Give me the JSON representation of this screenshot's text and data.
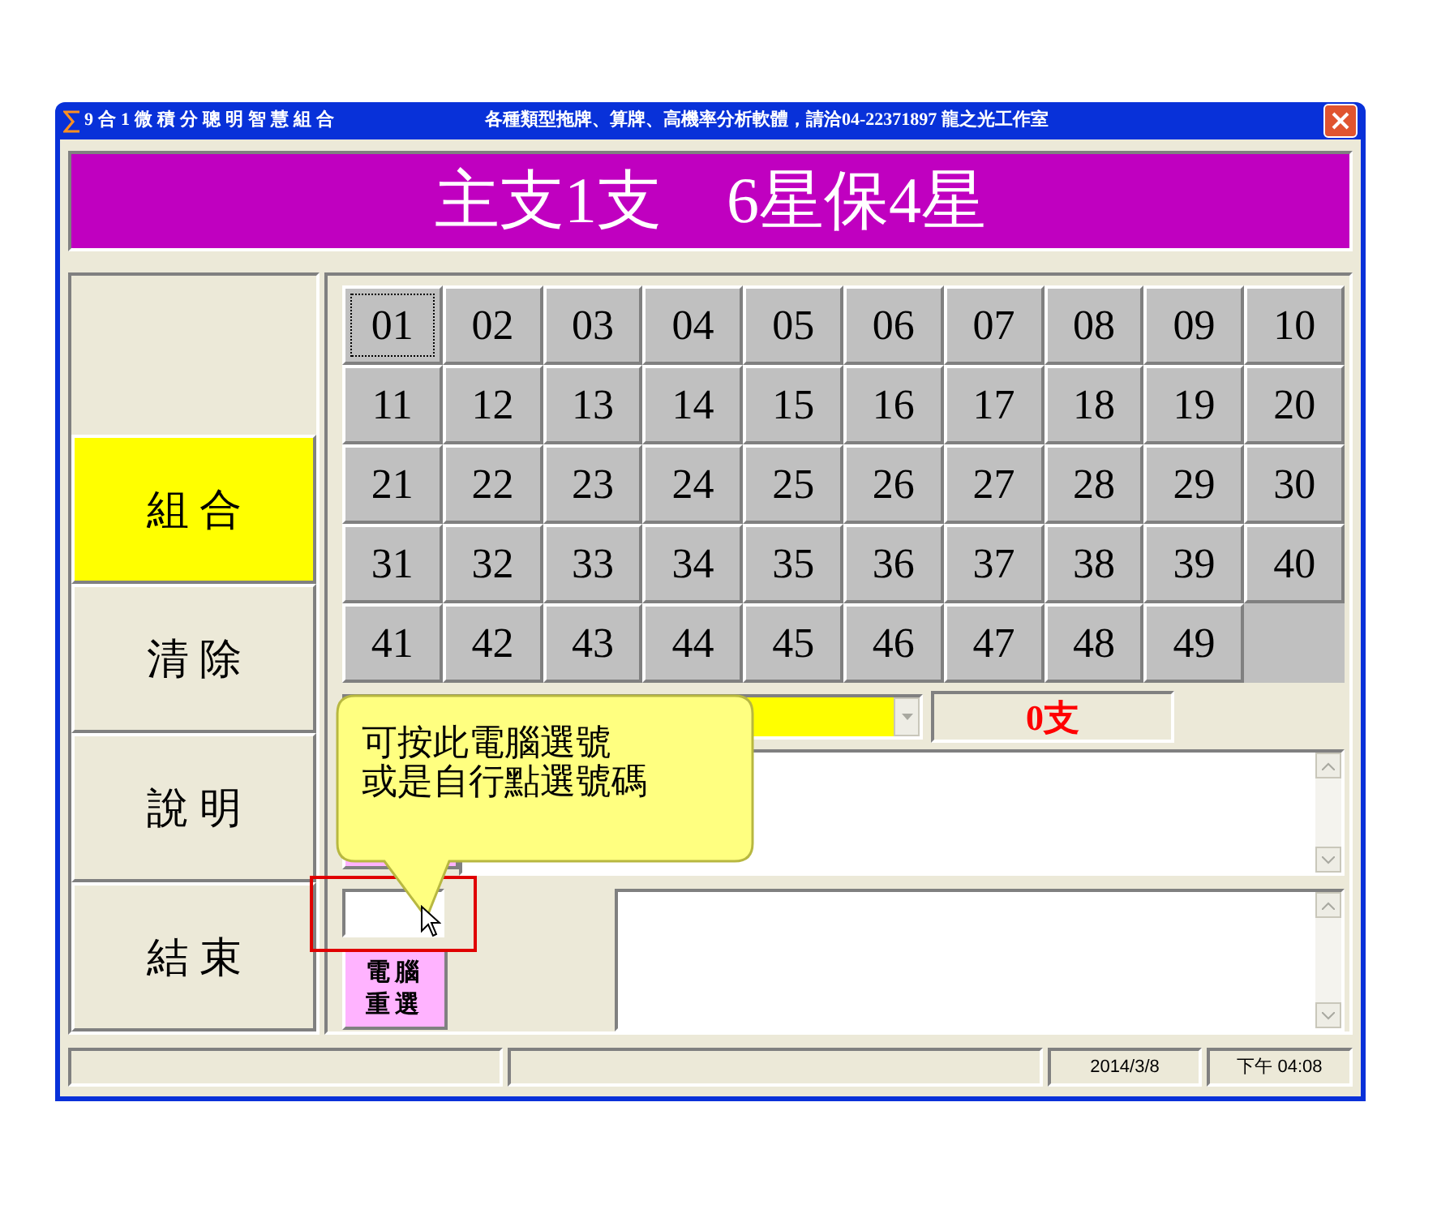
{
  "window": {
    "title": "9合1微積分聰明智慧組合",
    "subtitle": "各種類型拖牌、算牌、高機率分析軟體，請洽04-22371897 龍之光工作室"
  },
  "banner": "主支1支　6星保4星",
  "side_buttons": [
    {
      "label": "組 合",
      "selected": true
    },
    {
      "label": "清 除",
      "selected": false
    },
    {
      "label": "說 明",
      "selected": false
    },
    {
      "label": "結 束",
      "selected": false
    }
  ],
  "numbers": [
    {
      "label": "01",
      "selected": true
    },
    {
      "label": "02",
      "selected": false
    },
    {
      "label": "03",
      "selected": false
    },
    {
      "label": "04",
      "selected": false
    },
    {
      "label": "05",
      "selected": false
    },
    {
      "label": "06",
      "selected": false
    },
    {
      "label": "07",
      "selected": false
    },
    {
      "label": "08",
      "selected": false
    },
    {
      "label": "09",
      "selected": false
    },
    {
      "label": "10",
      "selected": false
    },
    {
      "label": "11",
      "selected": false
    },
    {
      "label": "12",
      "selected": false
    },
    {
      "label": "13",
      "selected": false
    },
    {
      "label": "14",
      "selected": false
    },
    {
      "label": "15",
      "selected": false
    },
    {
      "label": "16",
      "selected": false
    },
    {
      "label": "17",
      "selected": false
    },
    {
      "label": "18",
      "selected": false
    },
    {
      "label": "19",
      "selected": false
    },
    {
      "label": "20",
      "selected": false
    },
    {
      "label": "21",
      "selected": false
    },
    {
      "label": "22",
      "selected": false
    },
    {
      "label": "23",
      "selected": false
    },
    {
      "label": "24",
      "selected": false
    },
    {
      "label": "25",
      "selected": false
    },
    {
      "label": "26",
      "selected": false
    },
    {
      "label": "27",
      "selected": false
    },
    {
      "label": "28",
      "selected": false
    },
    {
      "label": "29",
      "selected": false
    },
    {
      "label": "30",
      "selected": false
    },
    {
      "label": "31",
      "selected": false
    },
    {
      "label": "32",
      "selected": false
    },
    {
      "label": "33",
      "selected": false
    },
    {
      "label": "34",
      "selected": false
    },
    {
      "label": "35",
      "selected": false
    },
    {
      "label": "36",
      "selected": false
    },
    {
      "label": "37",
      "selected": false
    },
    {
      "label": "38",
      "selected": false
    },
    {
      "label": "39",
      "selected": false
    },
    {
      "label": "40",
      "selected": false
    },
    {
      "label": "41",
      "selected": false
    },
    {
      "label": "42",
      "selected": false
    },
    {
      "label": "43",
      "selected": false
    },
    {
      "label": "44",
      "selected": false
    },
    {
      "label": "45",
      "selected": false
    },
    {
      "label": "46",
      "selected": false
    },
    {
      "label": "47",
      "selected": false
    },
    {
      "label": "48",
      "selected": false
    },
    {
      "label": "49",
      "selected": false
    }
  ],
  "count": "0支",
  "callout": [
    "可按此電腦選號",
    "或是自行點選號碼"
  ],
  "reselect_button": [
    "電腦",
    "重選"
  ],
  "status_bar": {
    "date": "2014/3/8",
    "time": "下午 04:08"
  }
}
